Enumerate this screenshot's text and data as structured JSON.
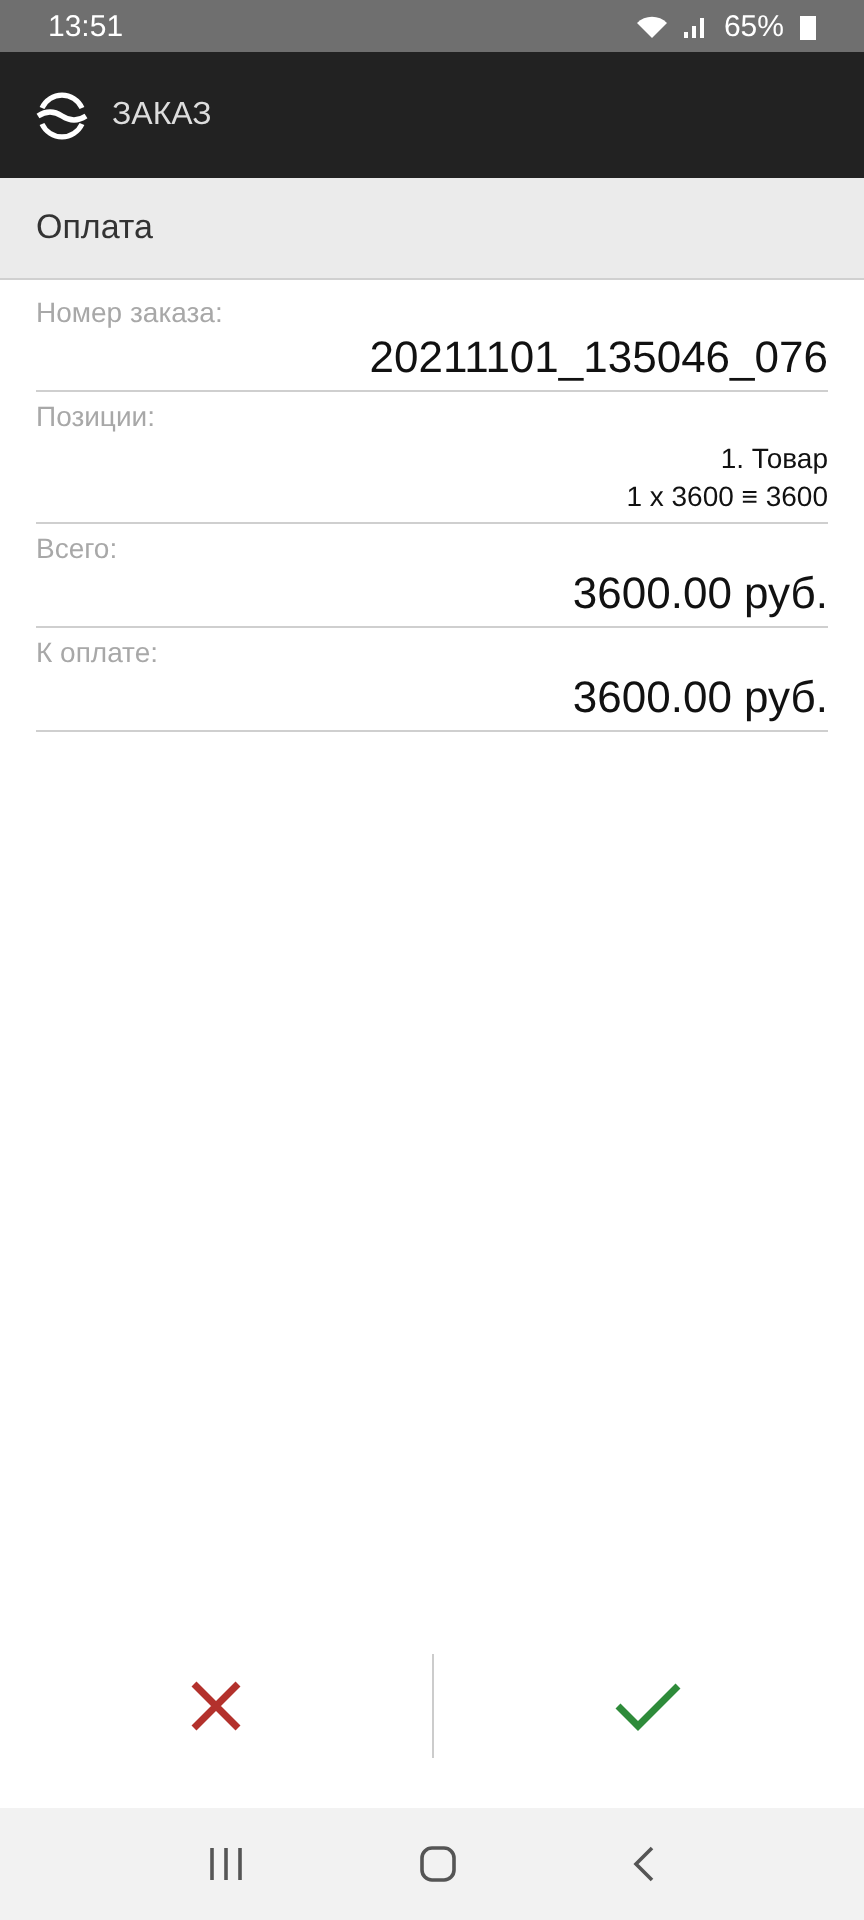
{
  "status_bar": {
    "time": "13:51",
    "battery": "65%"
  },
  "app_bar": {
    "title": "ЗАКАЗ"
  },
  "section": {
    "title": "Оплата"
  },
  "fields": [
    {
      "kind": "large",
      "label": "Номер заказа:",
      "value": "20211101_135046_076"
    },
    {
      "kind": "lines",
      "label": "Позиции:",
      "lines": [
        "1. Товар",
        "1 x 3600 ≡ 3600"
      ]
    },
    {
      "kind": "large",
      "label": "Всего:",
      "value": "3600.00 руб."
    },
    {
      "kind": "large",
      "label": "К оплате:",
      "value": "3600.00 руб."
    }
  ]
}
